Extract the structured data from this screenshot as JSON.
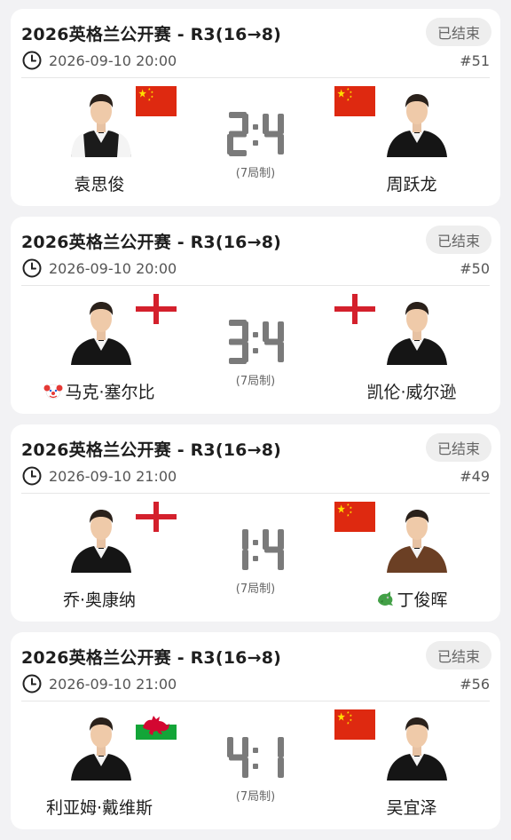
{
  "format_label": "(7局制)",
  "status_label": "已结束",
  "matches": [
    {
      "title": "2026英格兰公开赛 - R3(16→8)",
      "time": "2026-09-10 20:00",
      "number": "#51",
      "p1": {
        "name": "袁思俊",
        "flag": "china",
        "emoji": "",
        "photo": "suit-white-shirt"
      },
      "p2": {
        "name": "周跃龙",
        "flag": "china",
        "emoji": "",
        "photo": "suit-dark"
      },
      "score": {
        "p1": 2,
        "p2": 4
      }
    },
    {
      "title": "2026英格兰公开赛 - R3(16→8)",
      "time": "2026-09-10 20:00",
      "number": "#50",
      "p1": {
        "name": "马克·塞尔比",
        "flag": "england",
        "emoji": "clown-face-icon",
        "photo": "suit-dark"
      },
      "p2": {
        "name": "凯伦·威尔逊",
        "flag": "england",
        "emoji": "",
        "photo": "suit-dark"
      },
      "score": {
        "p1": 3,
        "p2": 4
      }
    },
    {
      "title": "2026英格兰公开赛 - R3(16→8)",
      "time": "2026-09-10 21:00",
      "number": "#49",
      "p1": {
        "name": "乔·奥康纳",
        "flag": "england",
        "emoji": "",
        "photo": "suit-dark"
      },
      "p2": {
        "name": "丁俊晖",
        "flag": "china",
        "emoji": "dragon-icon",
        "photo": "suit-brown-vest"
      },
      "score": {
        "p1": 1,
        "p2": 4
      }
    },
    {
      "title": "2026英格兰公开赛 - R3(16→8)",
      "time": "2026-09-10 21:00",
      "number": "#56",
      "p1": {
        "name": "利亚姆·戴维斯",
        "flag": "wales",
        "emoji": "",
        "photo": "suit-dark"
      },
      "p2": {
        "name": "吴宜泽",
        "flag": "china",
        "emoji": "",
        "photo": "suit-dark"
      },
      "score": {
        "p1": 4,
        "p2": 1
      }
    }
  ]
}
